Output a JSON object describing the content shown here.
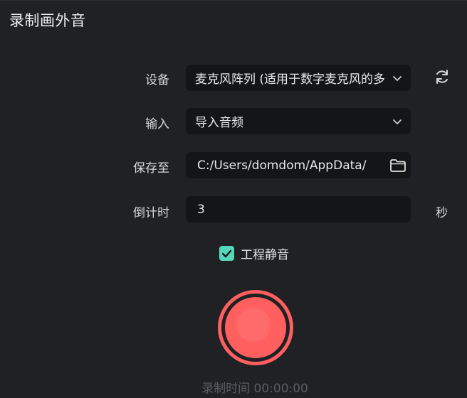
{
  "dialog": {
    "title": "录制画外音"
  },
  "device": {
    "label": "设备",
    "value": "麦克风阵列 (适用于数字麦克风的多"
  },
  "input": {
    "label": "输入",
    "value": "导入音频"
  },
  "save": {
    "label": "保存至",
    "value": "C:/Users/domdom/AppData/"
  },
  "countdown": {
    "label": "倒计时",
    "value": "3",
    "unit": "秒"
  },
  "mute": {
    "label": "工程静音",
    "checked": true
  },
  "record": {
    "time_text": "录制时间 00:00:00",
    "color": "#ff5f5f"
  },
  "colors": {
    "accent": "#55d6b8",
    "background": "#1f2124",
    "field": "#141517"
  }
}
